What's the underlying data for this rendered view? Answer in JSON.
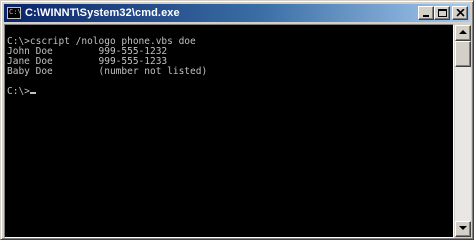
{
  "window": {
    "title": "C:\\WINNT\\System32\\cmd.exe",
    "icon": "console-icon",
    "icon_glyph": "C:\\",
    "buttons": [
      "minimize-icon",
      "maximize-icon",
      "close-icon"
    ]
  },
  "console": {
    "lines": [
      "",
      "C:\\>cscript /nologo phone.vbs doe",
      "John Doe        999-555-1232",
      "Jane Doe        999-555-1233",
      "Baby Doe        (number not listed)",
      "",
      "C:\\>"
    ],
    "text_color": "#c0c0c0",
    "background_color": "#000000"
  },
  "colors": {
    "titlebar_start": "#0a246a",
    "titlebar_end": "#a6caf0",
    "chrome": "#d4d0c8"
  }
}
